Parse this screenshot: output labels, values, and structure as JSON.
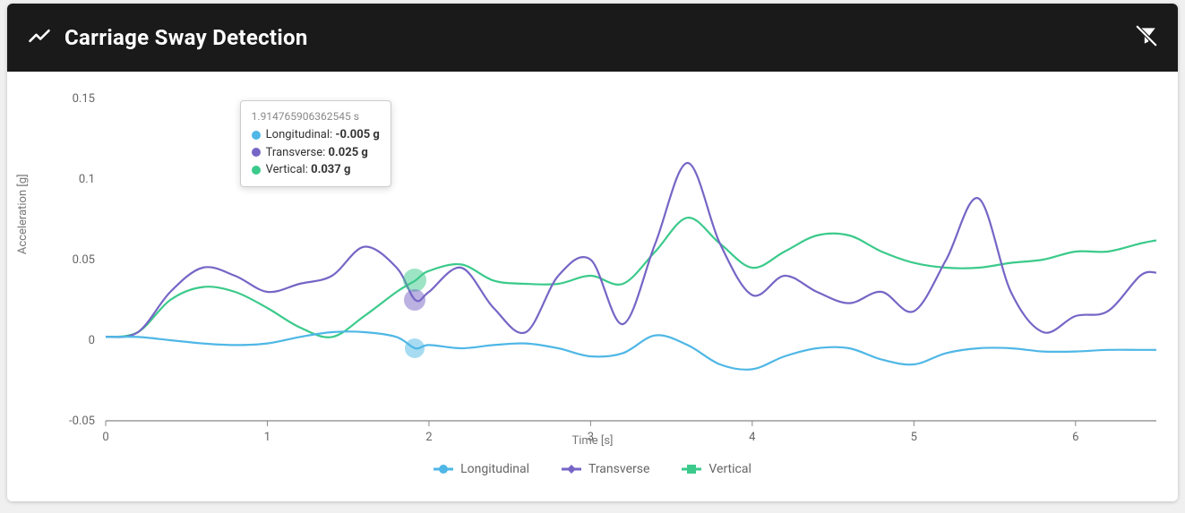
{
  "header": {
    "title": "Carriage Sway Detection",
    "icon": "line-chart-icon",
    "filter_icon": "filter-off-icon"
  },
  "axes": {
    "ylabel": "Acceleration [g]",
    "xlabel": "Time [s]",
    "yticks": [
      "-0.05",
      "0",
      "0.05",
      "0.1",
      "0.15"
    ],
    "xticks": [
      "0",
      "1",
      "2",
      "3",
      "4",
      "5",
      "6"
    ],
    "xlim": [
      0,
      6.5
    ],
    "ylim": [
      -0.05,
      0.15
    ]
  },
  "colors": {
    "longitudinal": "#4fb7e6",
    "transverse": "#7765c6",
    "vertical": "#3bca8b"
  },
  "legend": {
    "longitudinal": "Longitudinal",
    "transverse": "Transverse",
    "vertical": "Vertical"
  },
  "tooltip": {
    "time_label": "1.914765906362545 s",
    "rows": {
      "longitudinal": {
        "name": "Longitudinal",
        "value": "-0.005 g"
      },
      "transverse": {
        "name": "Transverse",
        "value": "0.025 g"
      },
      "vertical": {
        "name": "Vertical",
        "value": "0.037 g"
      }
    },
    "hover_x": 1.9147659
  },
  "chart_data": {
    "type": "line",
    "title": "Carriage Sway Detection",
    "xlabel": "Time [s]",
    "ylabel": "Acceleration [g]",
    "xlim": [
      0,
      6.5
    ],
    "ylim": [
      -0.05,
      0.15
    ],
    "x": [
      0.0,
      0.2,
      0.4,
      0.6,
      0.8,
      1.0,
      1.2,
      1.4,
      1.6,
      1.8,
      1.9147659,
      2.0,
      2.2,
      2.4,
      2.6,
      2.8,
      3.0,
      3.2,
      3.4,
      3.6,
      3.8,
      4.0,
      4.2,
      4.4,
      4.6,
      4.8,
      5.0,
      5.2,
      5.4,
      5.6,
      5.8,
      6.0,
      6.2,
      6.4,
      6.5
    ],
    "series": [
      {
        "name": "Longitudinal",
        "color": "#4fb7e6",
        "values": [
          0.002,
          0.002,
          0.0,
          -0.002,
          -0.003,
          -0.002,
          0.002,
          0.005,
          0.005,
          0.002,
          -0.005,
          -0.003,
          -0.005,
          -0.003,
          -0.002,
          -0.005,
          -0.01,
          -0.008,
          0.003,
          -0.003,
          -0.015,
          -0.018,
          -0.01,
          -0.005,
          -0.005,
          -0.012,
          -0.015,
          -0.008,
          -0.005,
          -0.005,
          -0.007,
          -0.007,
          -0.006,
          -0.006,
          -0.006
        ]
      },
      {
        "name": "Transverse",
        "color": "#7765c6",
        "values": [
          0.002,
          0.005,
          0.03,
          0.045,
          0.04,
          0.03,
          0.035,
          0.04,
          0.058,
          0.045,
          0.025,
          0.03,
          0.045,
          0.02,
          0.005,
          0.04,
          0.05,
          0.01,
          0.06,
          0.11,
          0.06,
          0.028,
          0.04,
          0.03,
          0.023,
          0.03,
          0.018,
          0.05,
          0.088,
          0.03,
          0.005,
          0.015,
          0.018,
          0.04,
          0.042
        ]
      },
      {
        "name": "Vertical",
        "color": "#3bca8b",
        "values": [
          0.002,
          0.005,
          0.025,
          0.033,
          0.03,
          0.02,
          0.008,
          0.002,
          0.015,
          0.03,
          0.037,
          0.043,
          0.047,
          0.037,
          0.035,
          0.035,
          0.04,
          0.035,
          0.055,
          0.076,
          0.06,
          0.045,
          0.055,
          0.065,
          0.065,
          0.055,
          0.048,
          0.045,
          0.045,
          0.048,
          0.05,
          0.055,
          0.055,
          0.06,
          0.062
        ]
      }
    ]
  }
}
